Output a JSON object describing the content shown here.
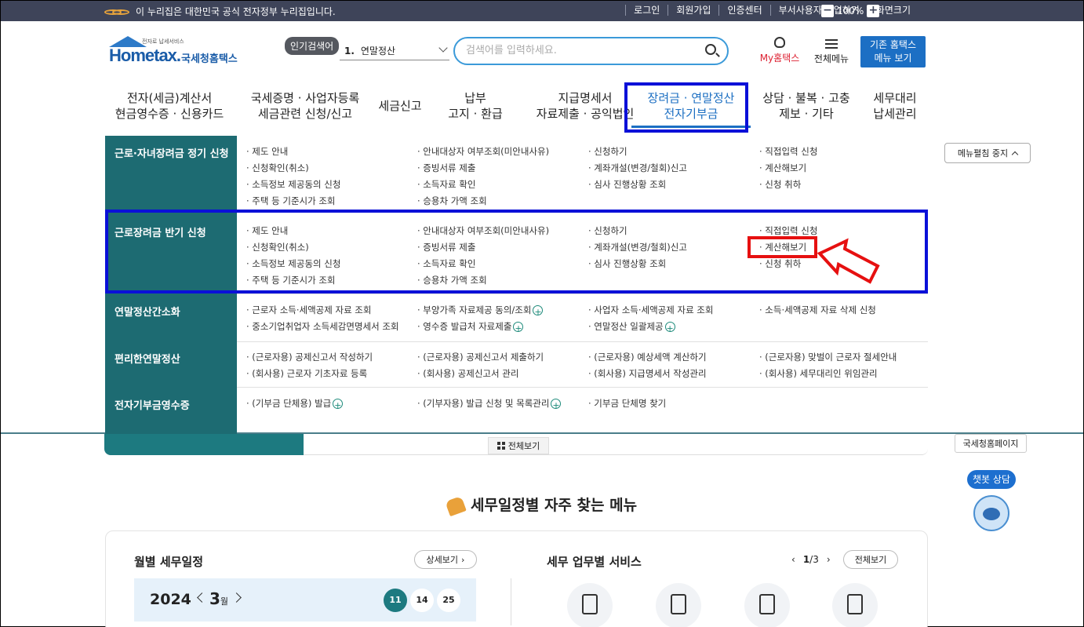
{
  "topbar": {
    "gov_notice": "이 누리집은 대한민국 공식 전자정부 누리집입니다.",
    "links": [
      "로그인",
      "회원가입",
      "인증센터",
      "부서사용자 가입하기",
      "화면크기"
    ],
    "zoom": "100%",
    "zoom_minus": "−",
    "zoom_plus": "+"
  },
  "header": {
    "logo_small": "전자로 납세서비스",
    "logo_brand": "Hometax.",
    "logo_ko": "국세청홈택스",
    "popular_badge": "인기검색어",
    "popular_num": "1.",
    "popular_term": "연말정산",
    "search_placeholder": "검색어를 입력하세요.",
    "my_label": "My홈택스",
    "allmenu_label": "전체메뉴",
    "old_btn_line1": "기존 홈택스",
    "old_btn_line2": "메뉴 보기"
  },
  "nav": [
    {
      "l1": "전자(세금)계산서",
      "l2": "현금영수증 · 신용카드"
    },
    {
      "l1": "국세증명 · 사업자등록",
      "l2": "세금관련 신청/신고"
    },
    {
      "l1": "세금신고",
      "l2": ""
    },
    {
      "l1": "납부",
      "l2": "고지 · 환급"
    },
    {
      "l1": "지급명세서",
      "l2": "자료제출 · 공익법인"
    },
    {
      "l1": "장려금 · 연말정산",
      "l2": "전자기부금"
    },
    {
      "l1": "상담 · 불복 · 고충",
      "l2": "제보 · 기타"
    },
    {
      "l1": "세무대리",
      "l2": "납세관리"
    }
  ],
  "mega": {
    "collapse_label": "메뉴펼침 중지",
    "rows": [
      {
        "cat": "근로·자녀장려금 정기 신청",
        "items": [
          "· 제도 안내",
          "· 안내대상자 여부조회(미안내사유)",
          "· 신청하기",
          "· 직접입력 신청",
          "· 신청확인(취소)",
          "· 증빙서류 제출",
          "· 계좌개설(변경/철회)신고",
          "· 계산해보기",
          "· 소득정보 제공동의 신청",
          "· 소득자료 확인",
          "· 심사 진행상황 조회",
          "· 신청 취하",
          "· 주택 등 기준시가 조회",
          "· 승용차 가액 조회"
        ]
      },
      {
        "cat": "근로장려금 반기 신청",
        "items": [
          "· 제도 안내",
          "· 안내대상자 여부조회(미안내사유)",
          "· 신청하기",
          "· 직접입력 신청",
          "· 신청확인(취소)",
          "· 증빙서류 제출",
          "· 계좌개설(변경/철회)신고",
          "· 계산해보기",
          "· 소득정보 제공동의 신청",
          "· 소득자료 확인",
          "· 심사 진행상황 조회",
          "· 신청 취하",
          "· 주택 등 기준시가 조회",
          "· 승용차 가액 조회"
        ]
      },
      {
        "cat": "연말정산간소화",
        "items": [
          "· 근로자 소득·세액공제 자료 조회",
          "· 부양가족 자료제공 동의/조회",
          "· 사업자 소득·세액공제 자료 조회",
          "· 소득·세액공제 자료 삭제 신청",
          "· 중소기업취업자 소득세감면명세서 조회",
          "· 영수증 발급처 자료제출",
          "· 연말정산 일괄제공",
          ""
        ]
      },
      {
        "cat": "편리한연말정산",
        "items": [
          "· (근로자용) 공제신고서 작성하기",
          "· (근로자용) 공제신고서 제출하기",
          "· (근로자용) 예상세액 계산하기",
          "· (근로자용) 맞벌이 근로자 절세안내",
          "· (회사용) 근로자 기초자료 등록",
          "· (회사용) 공제신고서 관리",
          "· (회사용) 지급명세서 작성관리",
          "· (회사용) 세무대리인 위임관리"
        ]
      },
      {
        "cat": "전자기부금영수증",
        "items": [
          "· (기부금 단체용) 발급",
          "· (기부자용) 발급 신청 및 목록관리",
          "· 기부금 단체명 찾기",
          ""
        ]
      }
    ]
  },
  "below": {
    "viewall": "전체보기",
    "nts_home": "국세청홈페이지",
    "chatbot": "챗봇 상담",
    "section_title": "세무일정별 자주 찾는 메뉴",
    "monthly_title": "월별 세무일정",
    "detail": "상세보기",
    "year": "2024",
    "month": "3",
    "month_unit": "월",
    "days": [
      "11",
      "14",
      "25"
    ],
    "svc_title": "세무 업무별 서비스",
    "page_current": "1",
    "page_total": "/3",
    "svc_all": "전체보기"
  },
  "colors": {
    "topbar": "#3e4459",
    "teal": "#1d6b72",
    "accent_blue": "#1b6ec2",
    "highlight_box": "#0a10d8",
    "highlight_red": "#e61010"
  }
}
